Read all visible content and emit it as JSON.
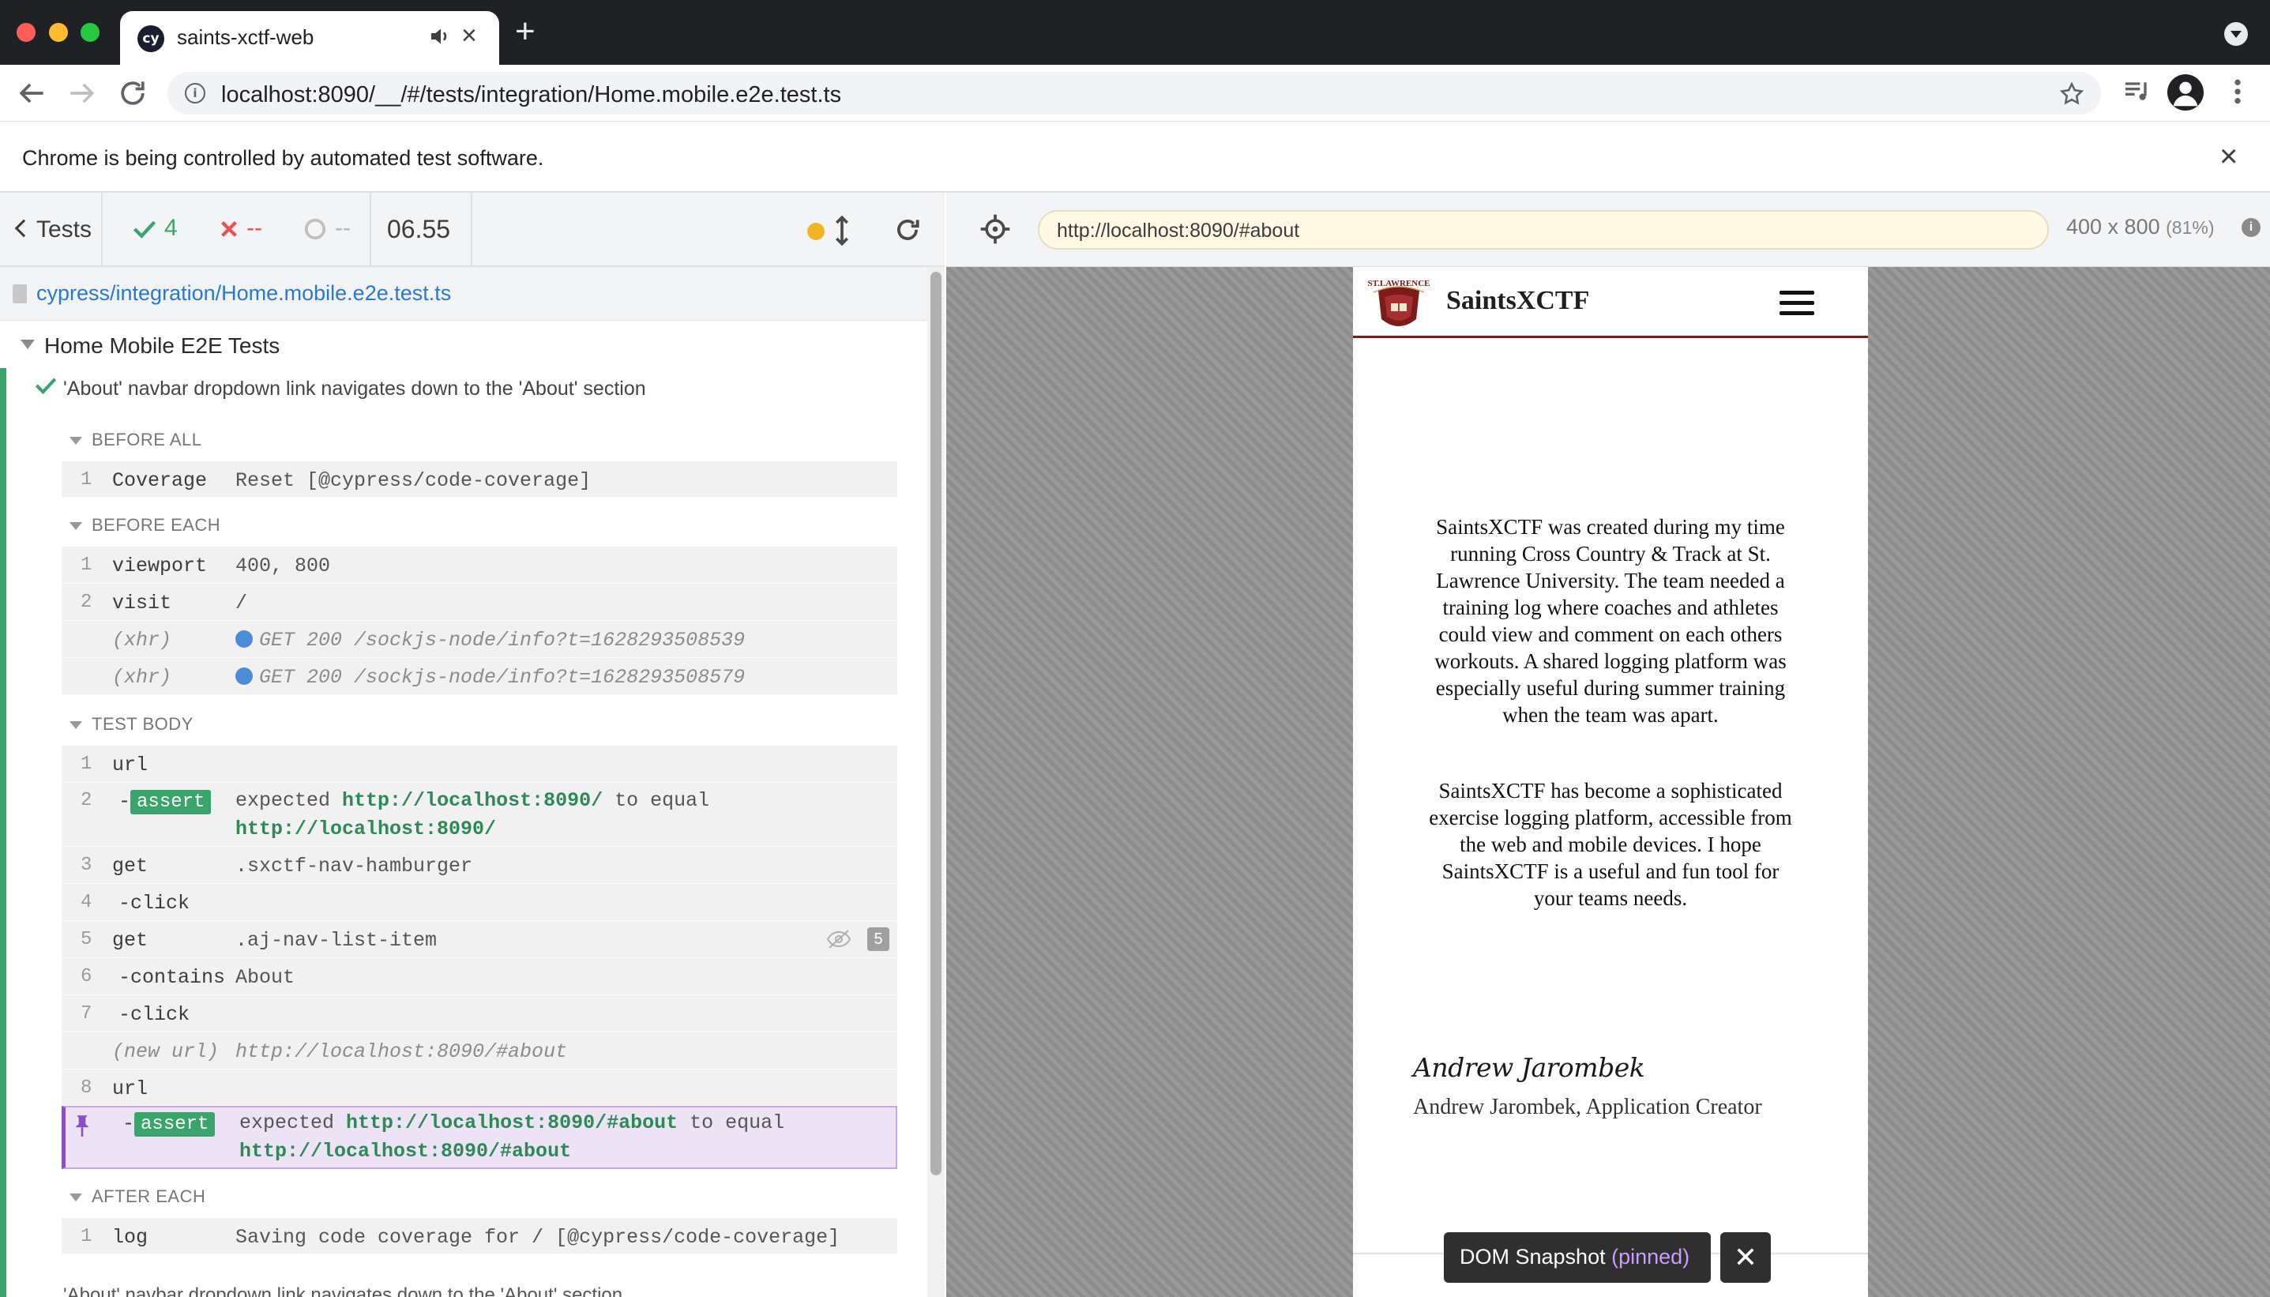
{
  "browser": {
    "tab_title": "saints-xctf-web",
    "favicon_text": "cy",
    "url": "localhost:8090/__/#/tests/integration/Home.mobile.e2e.test.ts",
    "infobar_text": "Chrome is being controlled by automated test software.",
    "close_glyph": "×",
    "new_tab_glyph": "+"
  },
  "reporter": {
    "tests_label": "Tests",
    "passed": "4",
    "failed": "--",
    "pending": "--",
    "duration": "06.55",
    "spec_path": "cypress/integration/Home.mobile.e2e.test.ts",
    "suite_title": "Home Mobile E2E Tests",
    "test_title": "'About' navbar dropdown link navigates down to the 'About' section",
    "hooks": {
      "before_all": "BEFORE ALL",
      "before_each": "BEFORE EACH",
      "test_body": "TEST BODY",
      "after_each": "AFTER EACH"
    },
    "before_all": [
      {
        "num": "1",
        "name": "Coverage",
        "msg": "Reset [@cypress/code-coverage]"
      }
    ],
    "before_each": [
      {
        "num": "1",
        "name": "viewport",
        "msg": "400, 800"
      },
      {
        "num": "2",
        "name": "visit",
        "msg": "/"
      },
      {
        "num": "",
        "name": "(xhr)",
        "msg": "GET 200 /sockjs-node/info?t=1628293508539"
      },
      {
        "num": "",
        "name": "(xhr)",
        "msg": "GET 200 /sockjs-node/info?t=1628293508579"
      }
    ],
    "test_body": {
      "c1": {
        "num": "1",
        "name": "url"
      },
      "c2": {
        "num": "2",
        "prefix": "-",
        "badge": "assert",
        "expected": "expected",
        "actual": "http://localhost:8090/",
        "to_equal": "to equal",
        "value": "http://localhost:8090/"
      },
      "c3": {
        "num": "3",
        "name": "get",
        "msg": ".sxctf-nav-hamburger"
      },
      "c4": {
        "num": "4",
        "name": "-click"
      },
      "c5": {
        "num": "5",
        "name": "get",
        "msg": ".aj-nav-list-item",
        "count": "5"
      },
      "c6": {
        "num": "6",
        "name": "-contains",
        "msg": "About"
      },
      "c7": {
        "num": "7",
        "name": "-click"
      },
      "c_newurl": {
        "name": "(new url)",
        "msg": "http://localhost:8090/#about"
      },
      "c8": {
        "num": "8",
        "name": "url"
      },
      "c9": {
        "prefix": "-",
        "badge": "assert",
        "expected": "expected",
        "actual": "http://localhost:8090/#about",
        "to_equal": "to equal",
        "value": "http://localhost:8090/#about"
      }
    },
    "after_each": [
      {
        "num": "1",
        "name": "log",
        "msg": "Saving code coverage for / [@cypress/code-coverage]"
      }
    ],
    "cut_text": "'About' navbar dropdown link navigates down to the 'About' section"
  },
  "aut": {
    "url": "http://localhost:8090/#about",
    "viewport_size": "400 x 800",
    "viewport_scale": "(81%)",
    "info_glyph": "i",
    "brand": "SaintsXCTF",
    "about_p1": "SaintsXCTF was created during my time running Cross Country & Track at St. Lawrence University. The team needed a training log where coaches and athletes could view and comment on each others workouts. A shared logging platform was especially useful during summer training when the team was apart.",
    "about_p2": "SaintsXCTF has become a sophisticated exercise logging platform, accessible from the web and mobile devices. I hope SaintsXCTF is a useful and fun tool for your teams needs.",
    "signature": "Andrew Jarombek",
    "caption": "Andrew Jarombek, Application Creator",
    "logo_text": "ST.LAWRENCE",
    "snapshot_label": "DOM Snapshot",
    "snapshot_pinned": "(pinned)",
    "snapshot_close": "✕"
  },
  "colors": {
    "pass": "#3aa56a",
    "fail": "#e94f4f",
    "link": "#2978d8",
    "pinned_accent": "#8b4fc8",
    "brand_maroon": "#7d1a1a"
  }
}
